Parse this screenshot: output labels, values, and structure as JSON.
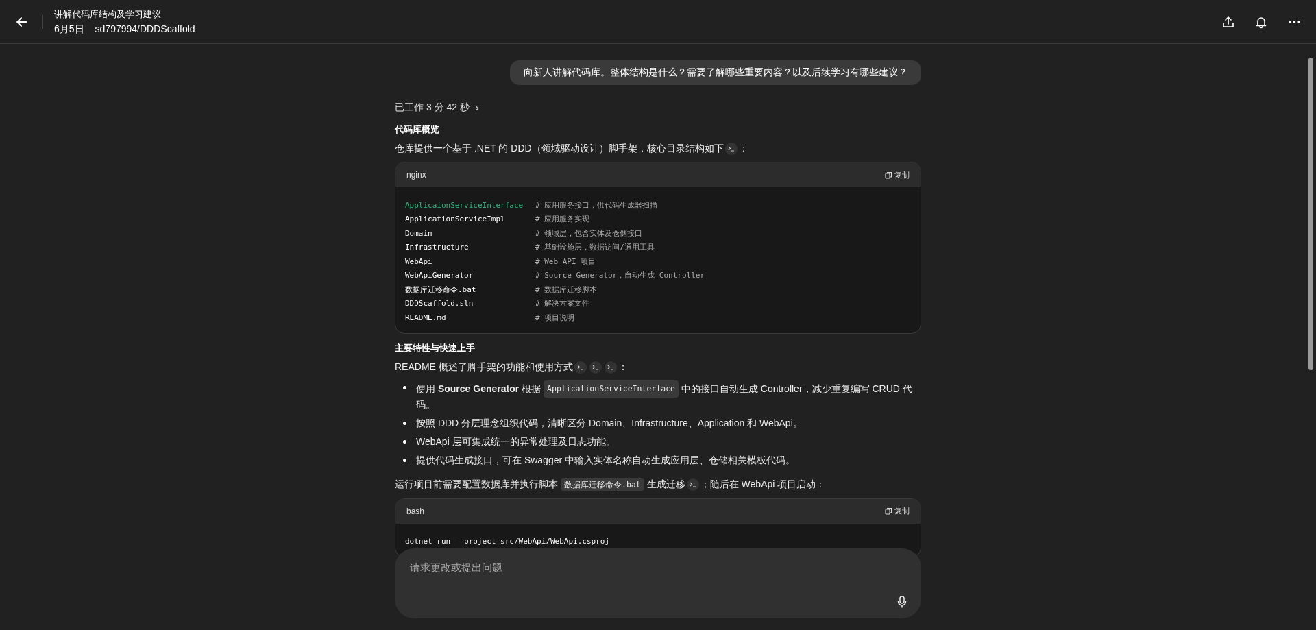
{
  "header": {
    "title": "讲解代码库结构及学习建议",
    "date": "6月5日",
    "repo": "sd797994/DDDScaffold"
  },
  "user_message": "向新人讲解代码库。整体结构是什么？需要了解哪些重要内容？以及后续学习有哪些建议？",
  "worked": {
    "label": "已工作 3 分 42 秒",
    "expanded": false
  },
  "blocks": [
    {
      "kind": "heading",
      "text": "代码库概览"
    },
    {
      "kind": "paragraph",
      "parts": [
        {
          "kind": "text",
          "text": "仓库提供一个基于 .NET 的 DDD（领域驱动设计）脚手架，核心目录结构如下"
        },
        {
          "kind": "cite"
        },
        {
          "kind": "text",
          "text": "："
        }
      ]
    },
    {
      "kind": "code_block",
      "lang": "nginx",
      "copy": "复制",
      "lines": [
        {
          "code": "ApplicaionServiceInterface",
          "comment": "# 应用服务接口，供代码生成器扫描",
          "highlight": true
        },
        {
          "code": "ApplicationServiceImpl",
          "comment": "# 应用服务实现",
          "highlight": false
        },
        {
          "code": "Domain",
          "comment": "# 领域层，包含实体及仓储接口",
          "highlight": false
        },
        {
          "code": "Infrastructure",
          "comment": "# 基础设施层，数据访问/通用工具",
          "highlight": false
        },
        {
          "code": "WebApi",
          "comment": "# Web API 项目",
          "highlight": false
        },
        {
          "code": "WebApiGenerator",
          "comment": "# Source Generator，自动生成 Controller",
          "highlight": false
        },
        {
          "code": "数据库迁移命令.bat",
          "comment": "# 数据库迁移脚本",
          "highlight": false
        },
        {
          "code": "DDDScaffold.sln",
          "comment": "# 解决方案文件",
          "highlight": false
        },
        {
          "code": "README.md",
          "comment": "# 项目说明",
          "highlight": false
        }
      ]
    },
    {
      "kind": "heading",
      "text": "主要特性与快速上手"
    },
    {
      "kind": "paragraph",
      "parts": [
        {
          "kind": "text",
          "text": "README 概述了脚手架的功能和使用方式"
        },
        {
          "kind": "cite"
        },
        {
          "kind": "cite"
        },
        {
          "kind": "cite"
        },
        {
          "kind": "text",
          "text": "："
        }
      ]
    },
    {
      "kind": "list",
      "items": [
        {
          "parts": [
            {
              "kind": "text",
              "text": "使用 **Source Generator** 根据"
            },
            {
              "kind": "code",
              "text": "ApplicationServiceInterface"
            },
            {
              "kind": "text",
              "text": "中的接口自动生成 Controller，减少重复编写 CRUD 代"
            },
            {
              "kind": "text",
              "text": "码。"
            }
          ]
        },
        {
          "parts": [
            {
              "kind": "text",
              "text": "按照 DDD 分层理念组织代码，清晰区分 Domain、Infrastructure、Application 和 WebApi。"
            }
          ]
        },
        {
          "parts": [
            {
              "kind": "text",
              "text": "WebApi 层可集成统一的异常处理及日志功能。"
            }
          ]
        },
        {
          "parts": [
            {
              "kind": "text",
              "text": "提供代码生成接口，可在 Swagger 中输入实体名称自动生成应用层、仓储相关模板代码。"
            }
          ]
        }
      ]
    },
    {
      "kind": "paragraph",
      "parts": [
        {
          "kind": "text",
          "text": "运行项目前需要配置数据库并执行脚本"
        },
        {
          "kind": "code",
          "text": "数据库迁移命令.bat"
        },
        {
          "kind": "text",
          "text": "生成迁移"
        },
        {
          "kind": "cite"
        },
        {
          "kind": "text",
          "text": "；随后在 WebApi 项目启动："
        }
      ]
    },
    {
      "kind": "code_block",
      "lang": "bash",
      "copy": "复制",
      "lines": [
        {
          "code": "dotnet run --project src/WebApi/WebApi.csproj",
          "highlight": false
        }
      ]
    }
  ],
  "composer": {
    "placeholder": "请求更改或提出问题"
  }
}
